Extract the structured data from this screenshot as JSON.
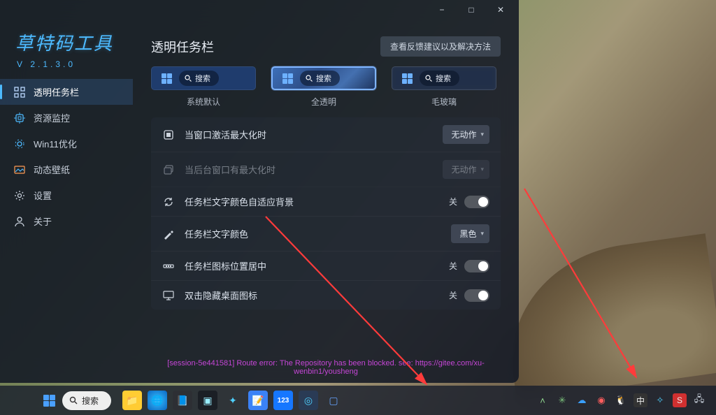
{
  "window": {
    "minimize": "−",
    "maximize": "□",
    "close": "✕"
  },
  "brand": {
    "name": "草特码工具",
    "version": "V 2.1.3.0"
  },
  "sidebar": {
    "items": [
      {
        "label": "透明任务栏",
        "active": true
      },
      {
        "label": "资源监控"
      },
      {
        "label": "Win11优化"
      },
      {
        "label": "动态壁纸"
      },
      {
        "label": "设置"
      },
      {
        "label": "关于"
      }
    ]
  },
  "page": {
    "title": "透明任务栏",
    "feedback": "查看反馈建议以及解决方法"
  },
  "previews": {
    "search_text": "搜索",
    "labels": {
      "default": "系统默认",
      "trans": "全透明",
      "glass": "毛玻璃"
    }
  },
  "settings": {
    "row0": {
      "label": "当窗口激活最大化时",
      "value": "无动作"
    },
    "row1": {
      "label": "当后台窗口有最大化时",
      "value": "无动作"
    },
    "row2": {
      "label": "任务栏文字颜色自适应背景",
      "state": "关"
    },
    "row3": {
      "label": "任务栏文字颜色",
      "value": "黑色"
    },
    "row4": {
      "label": "任务栏图标位置居中",
      "state": "关"
    },
    "row5": {
      "label": "双击隐藏桌面图标",
      "state": "关"
    }
  },
  "error": "[session-5e441581] Route error: The Repository has been blocked. see: https://gitee.com/xu-wenbin1/yousheng",
  "taskbar": {
    "search": "搜索",
    "ime1": "中",
    "ime2": "S"
  }
}
